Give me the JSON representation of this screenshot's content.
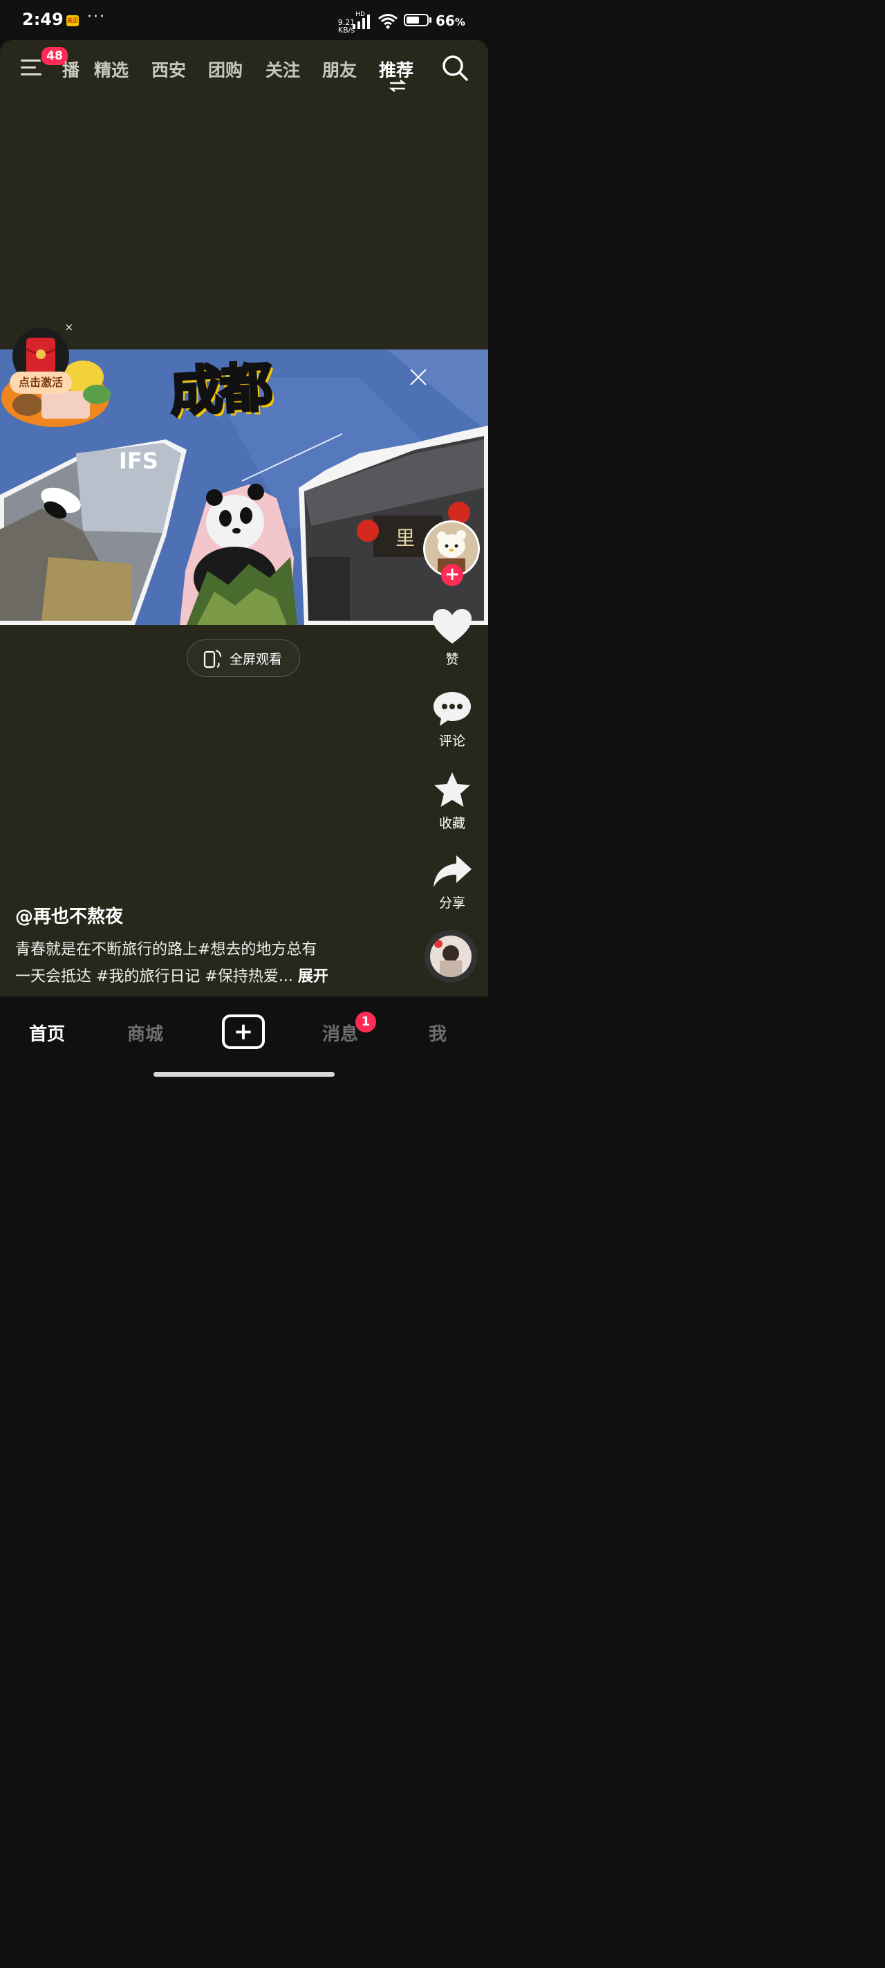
{
  "status_bar": {
    "time": "2:49",
    "app_icon_text": "美团",
    "dots": "···",
    "speed_value": "9.21",
    "speed_unit": "KB/s",
    "network_label": "HD",
    "battery_percent": "66",
    "battery_unit": "%",
    "battery_level": 0.66
  },
  "top_nav": {
    "menu_badge": "48",
    "tabs": [
      {
        "label": "播",
        "active": false
      },
      {
        "label": "精选",
        "active": false
      },
      {
        "label": "西安",
        "active": false
      },
      {
        "label": "团购",
        "active": false
      },
      {
        "label": "关注",
        "active": false
      },
      {
        "label": "朋友",
        "active": false
      },
      {
        "label": "推荐",
        "active": true
      }
    ],
    "icons": [
      "menu-icon",
      "swap-icon",
      "search-icon"
    ]
  },
  "video": {
    "title_text": "成都",
    "sign_text": "IFS",
    "plaque_text": "里",
    "fullscreen_label": "全屏观看"
  },
  "float_widget": {
    "activate_label": "点击激活",
    "close_label": "×"
  },
  "actions": {
    "follow_label": "+",
    "like_label": "赞",
    "comment_label": "评论",
    "favorite_label": "收藏",
    "share_label": "分享"
  },
  "post": {
    "author": "@再也不熬夜",
    "caption_line1": "青春就是在不断旅行的路上#想去的地方总有",
    "caption_line2": "一天会抵达 #我的旅行日记 #保持热爱...",
    "expand_label": "展开"
  },
  "bottom_nav": {
    "home": "首页",
    "mall": "商城",
    "create": "+",
    "messages": "消息",
    "messages_badge": "1",
    "me": "我"
  },
  "colors": {
    "background": "#27281b",
    "accent": "#fe2c55",
    "video_blue": "#4e70b4"
  }
}
